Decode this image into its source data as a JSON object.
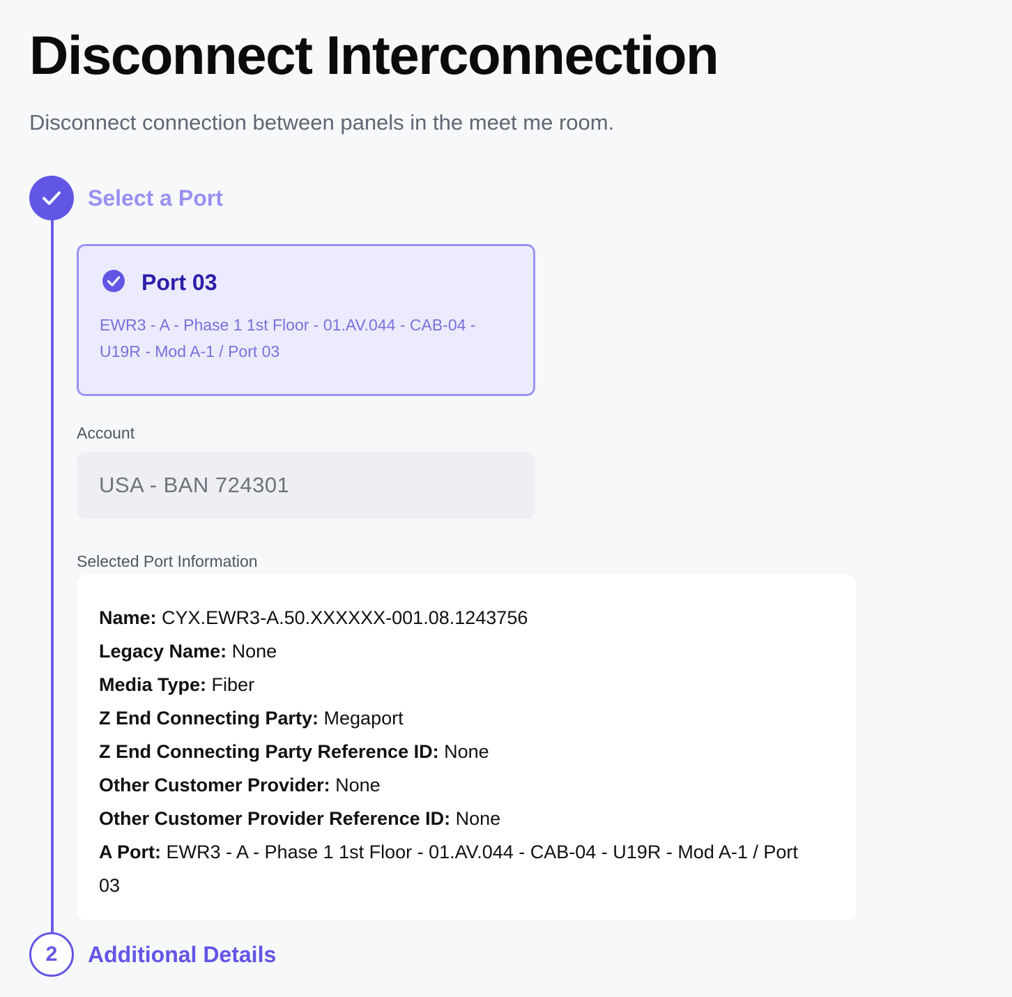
{
  "header": {
    "title": "Disconnect Interconnection",
    "subtitle": "Disconnect connection between panels in the meet me room."
  },
  "stepper": {
    "step1": {
      "label": "Select a Port",
      "status": "complete"
    },
    "step2": {
      "number": "2",
      "label": "Additional Details",
      "status": "current"
    }
  },
  "port_card": {
    "name": "Port 03",
    "description": "EWR3 - A - Phase 1 1st Floor - 01.AV.044 - CAB-04 - U19R - Mod A-1 / Port 03",
    "selected": true
  },
  "account": {
    "label": "Account",
    "value": "USA - BAN 724301"
  },
  "port_info": {
    "label": "Selected Port Information",
    "rows": [
      {
        "key": "Name:",
        "value": "CYX.EWR3-A.50.XXXXXX-001.08.1243756"
      },
      {
        "key": "Legacy Name:",
        "value": "None"
      },
      {
        "key": "Media Type:",
        "value": "Fiber"
      },
      {
        "key": "Z End Connecting Party:",
        "value": "Megaport"
      },
      {
        "key": "Z End Connecting Party Reference ID:",
        "value": "None"
      },
      {
        "key": "Other Customer Provider:",
        "value": "None"
      },
      {
        "key": "Other Customer Provider Reference ID:",
        "value": "None"
      },
      {
        "key": "A Port:",
        "value": "EWR3 - A - Phase 1 1st Floor - 01.AV.044 - CAB-04 - U19R - Mod A-1 / Port 03"
      }
    ]
  },
  "colors": {
    "accent": "#6256e4",
    "accent_light": "#9a90f0",
    "card_bg": "#ecebfd",
    "page_bg": "#f7f8fa"
  },
  "icons": {
    "step1": "checkmark-icon",
    "port_card": "check-circle-icon"
  }
}
